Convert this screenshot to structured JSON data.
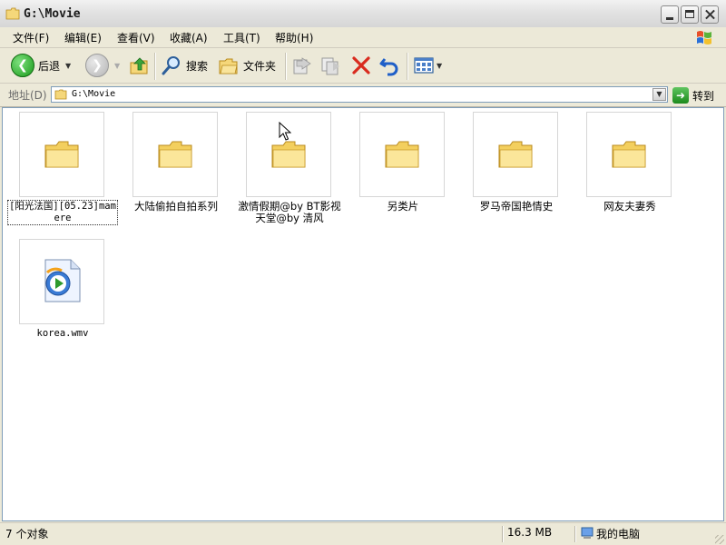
{
  "window": {
    "title": "G:\\Movie"
  },
  "menu": {
    "items": [
      "文件(F)",
      "编辑(E)",
      "查看(V)",
      "收藏(A)",
      "工具(T)",
      "帮助(H)"
    ]
  },
  "toolbar": {
    "back_label": "后退",
    "search_label": "搜索",
    "folders_label": "文件夹"
  },
  "address": {
    "label": "地址(D)",
    "value": "G:\\Movie",
    "go_label": "转到"
  },
  "items": [
    {
      "name": "[阳光法国][05.23]mamere",
      "type": "folder",
      "selected": true
    },
    {
      "name": "大陆偷拍自拍系列",
      "type": "folder"
    },
    {
      "name": "激情假期@by BT影视天堂@by 清风",
      "type": "folder"
    },
    {
      "name": "另类片",
      "type": "folder"
    },
    {
      "name": "罗马帝国艳情史",
      "type": "folder"
    },
    {
      "name": "网友夫妻秀",
      "type": "folder"
    },
    {
      "name": "korea.wmv",
      "type": "wmv-file"
    }
  ],
  "status": {
    "count": "7 个对象",
    "size": "16.3 MB",
    "location": "我的电脑"
  }
}
